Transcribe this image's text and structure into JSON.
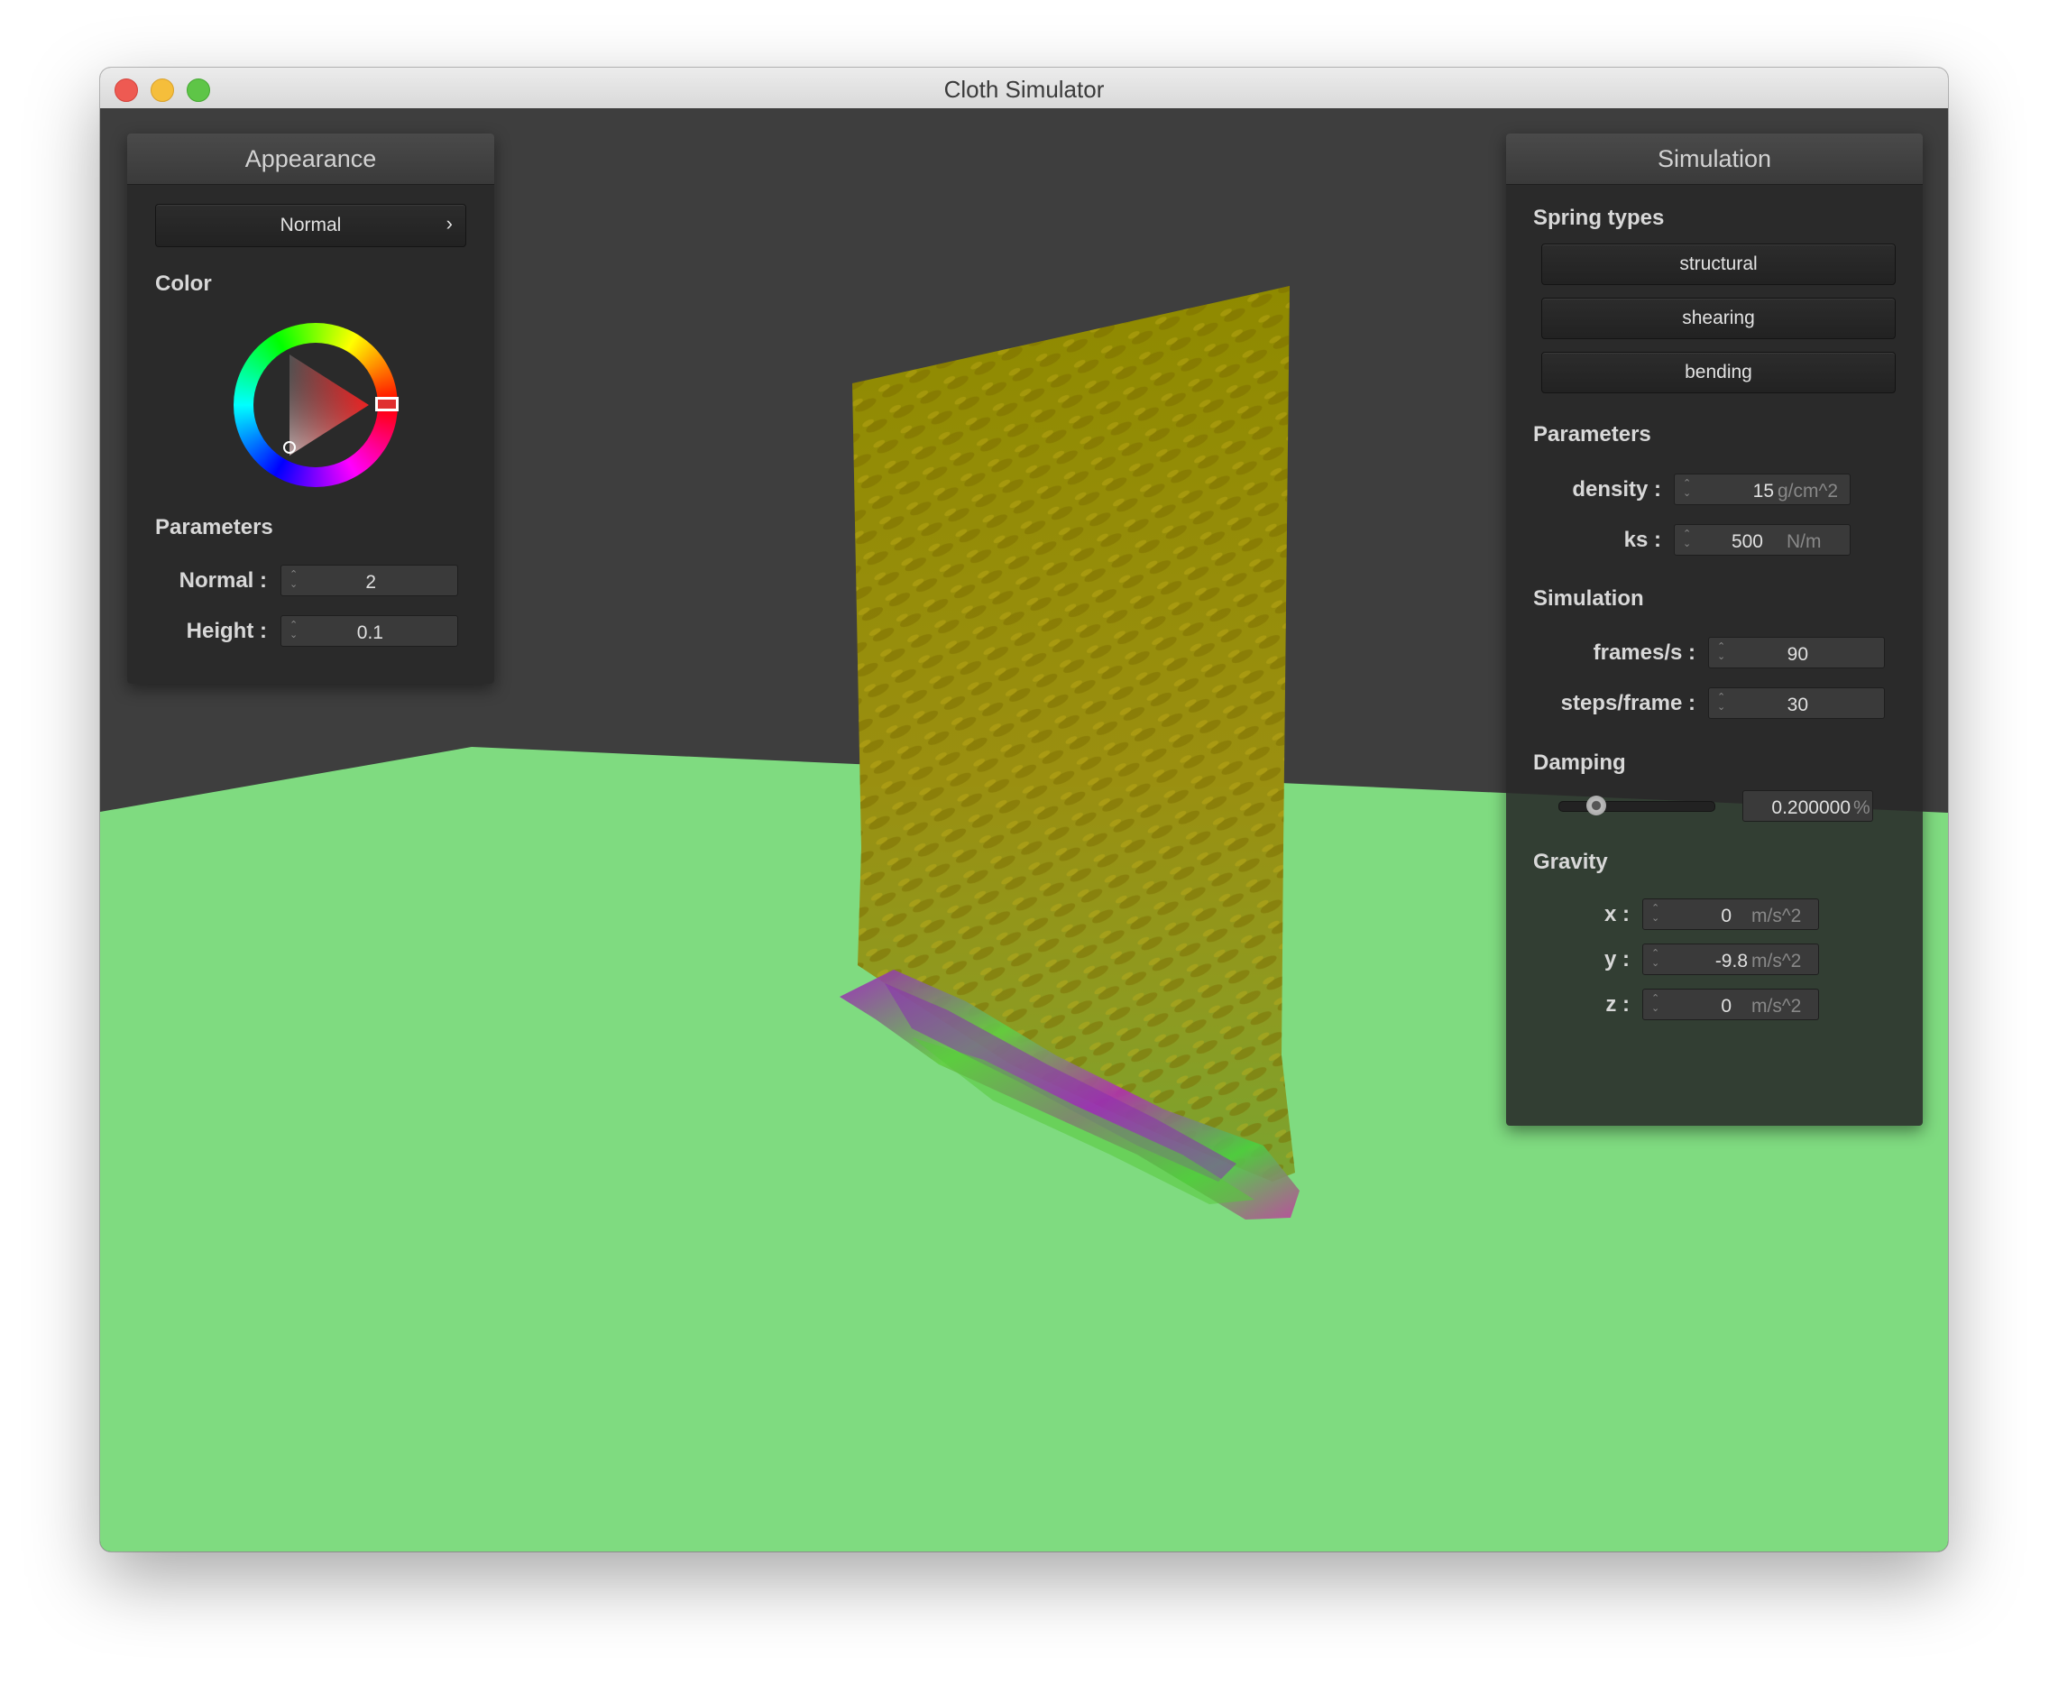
{
  "window": {
    "title": "Cloth Simulator"
  },
  "colors": {
    "ground": "#7fdb80",
    "backdrop": "#3e3e3e",
    "panel": "#282828",
    "hue_marker": "#e03030"
  },
  "appearance": {
    "header": "Appearance",
    "shader_dropdown": {
      "value": "Normal",
      "chevron": "›"
    },
    "color_label": "Color",
    "parameters_label": "Parameters",
    "normal": {
      "label": "Normal :",
      "value": "2"
    },
    "height": {
      "label": "Height :",
      "value": "0.1"
    }
  },
  "simulation": {
    "header": "Simulation",
    "spring_types_label": "Spring types",
    "springs": [
      {
        "label": "structural"
      },
      {
        "label": "shearing"
      },
      {
        "label": "bending"
      }
    ],
    "parameters_label": "Parameters",
    "density": {
      "label": "density :",
      "value": "15",
      "unit": "g/cm^2"
    },
    "ks": {
      "label": "ks :",
      "value": "500",
      "unit": "N/m"
    },
    "sim_label": "Simulation",
    "fps": {
      "label": "frames/s :",
      "value": "90"
    },
    "steps": {
      "label": "steps/frame :",
      "value": "30"
    },
    "damping_label": "Damping",
    "damping": {
      "value": "0.200000",
      "unit": "%",
      "slider_fraction": 0.2
    },
    "gravity_label": "Gravity",
    "gravity": [
      {
        "label": "x :",
        "value": "0",
        "unit": "m/s^2"
      },
      {
        "label": "y :",
        "value": "-9.8",
        "unit": "m/s^2"
      },
      {
        "label": "z :",
        "value": "0",
        "unit": "m/s^2"
      }
    ]
  }
}
